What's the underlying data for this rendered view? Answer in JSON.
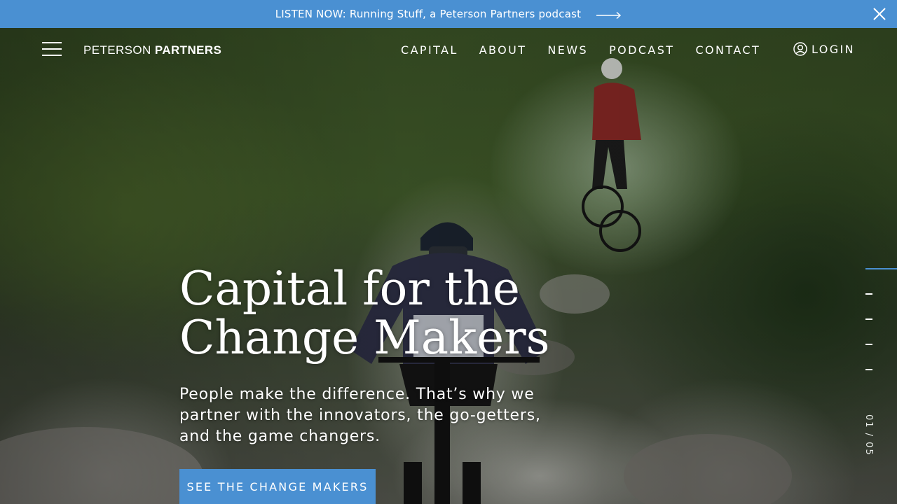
{
  "announcement": {
    "text": "LISTEN NOW: Running Stuff, a Peterson Partners podcast",
    "arrow_icon": "long-arrow-right-icon",
    "close_icon": "close-icon"
  },
  "header": {
    "logo_light": "PETERSON",
    "logo_bold": "PARTNERS",
    "menu_icon": "hamburger-menu-icon",
    "nav": [
      "CAPITAL",
      "ABOUT",
      "NEWS",
      "PODCAST",
      "CONTACT"
    ],
    "login_label": "LOGIN",
    "login_icon": "user-circle-icon"
  },
  "hero": {
    "headline_line1": "Capital for the",
    "headline_line2": "Change Makers",
    "subtext": "People make the difference. That’s why we partner with the innovators, the go-getters, and the game changers.",
    "cta_label": "SEE THE CHANGE MAKERS",
    "slide_counter": "01 / 05",
    "slide_current": 1,
    "slide_total": 5
  },
  "colors": {
    "accent": "#4a90d2",
    "text": "#ffffff"
  }
}
